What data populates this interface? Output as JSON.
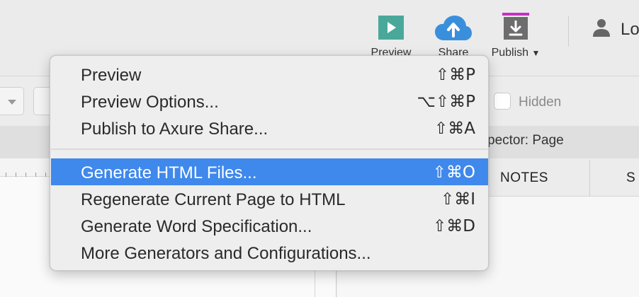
{
  "toolbar": {
    "preview_label": "Preview",
    "share_label": "Share",
    "publish_label": "Publish",
    "publish_caret": "▼",
    "user_label": "Lo",
    "icons": {
      "preview": "play-icon",
      "share": "cloud-upload-icon",
      "publish": "download-icon",
      "user": "user-icon"
    },
    "colors": {
      "preview": "#4aa89a",
      "share": "#3a8fdc",
      "publish": "#6d6d6d",
      "publish_accent": "#c631c4"
    }
  },
  "style_bar": {
    "hidden_label": "Hidden"
  },
  "inspector": {
    "title": "pector: Page",
    "tabs": [
      {
        "label": "NOTES"
      },
      {
        "label": "S"
      }
    ]
  },
  "menu": {
    "items": [
      {
        "label": "Preview",
        "shortcut": "⇧⌘P"
      },
      {
        "label": "Preview Options...",
        "shortcut": "⌥⇧⌘P"
      },
      {
        "label": "Publish to Axure Share...",
        "shortcut": "⇧⌘A"
      },
      {
        "label": "Generate HTML Files...",
        "shortcut": "⇧⌘O",
        "highlighted": true
      },
      {
        "label": "Regenerate Current Page to HTML",
        "shortcut": "⇧⌘I"
      },
      {
        "label": "Generate Word Specification...",
        "shortcut": "⇧⌘D"
      },
      {
        "label": "More Generators and Configurations...",
        "shortcut": ""
      }
    ],
    "highlight_color": "#3f88ec"
  }
}
